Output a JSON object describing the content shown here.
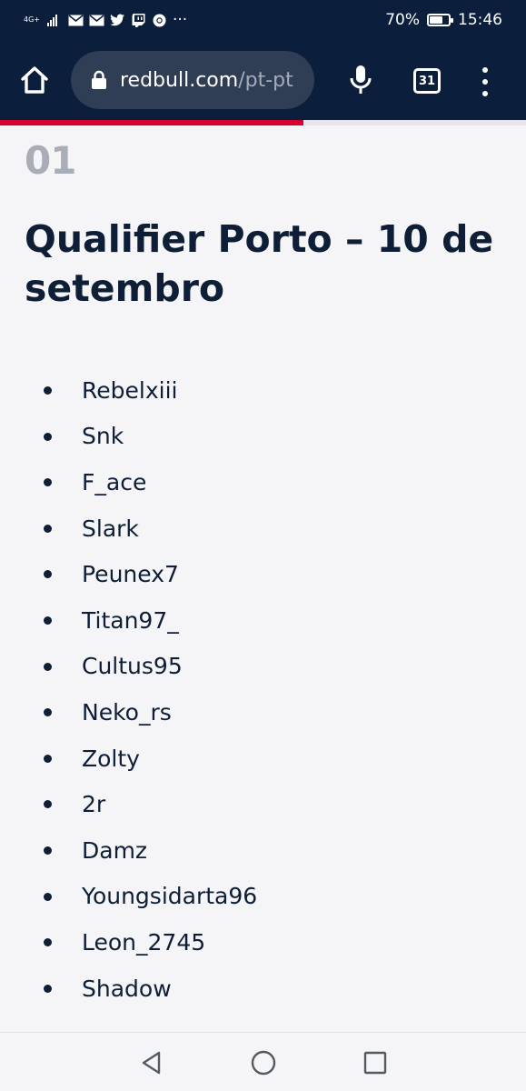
{
  "status_bar": {
    "network": "4G+",
    "battery_text": "70%",
    "battery_level": 0.7,
    "time": "15:46",
    "notification_icons": [
      "mail-icon",
      "mail-icon",
      "twitter-icon",
      "twitch-icon",
      "chrome-icon"
    ],
    "more": "···"
  },
  "browser": {
    "url_domain": "redbull.com",
    "url_path": "/pt-pt",
    "tab_count": "31",
    "page_load_progress": 0.577
  },
  "article": {
    "section_number": "01",
    "title": "Qualifier Porto – 10 de setembro",
    "players": [
      "Rebelxiii",
      "Snk",
      "F_ace",
      "Slark",
      "Peunex7",
      "Titan97_",
      "Cultus95",
      "Neko_rs",
      "Zolty",
      "2r",
      "Damz",
      "Youngsidarta96",
      "Leon_2745",
      "Shadow"
    ]
  },
  "colors": {
    "chrome_bg": "#0b1f3c",
    "url_bg": "#2f3d55",
    "accent_red": "#d6002f",
    "text_dark": "#0d1e36",
    "section_grey": "#a9adb5",
    "page_bg": "#f5f5f7"
  }
}
